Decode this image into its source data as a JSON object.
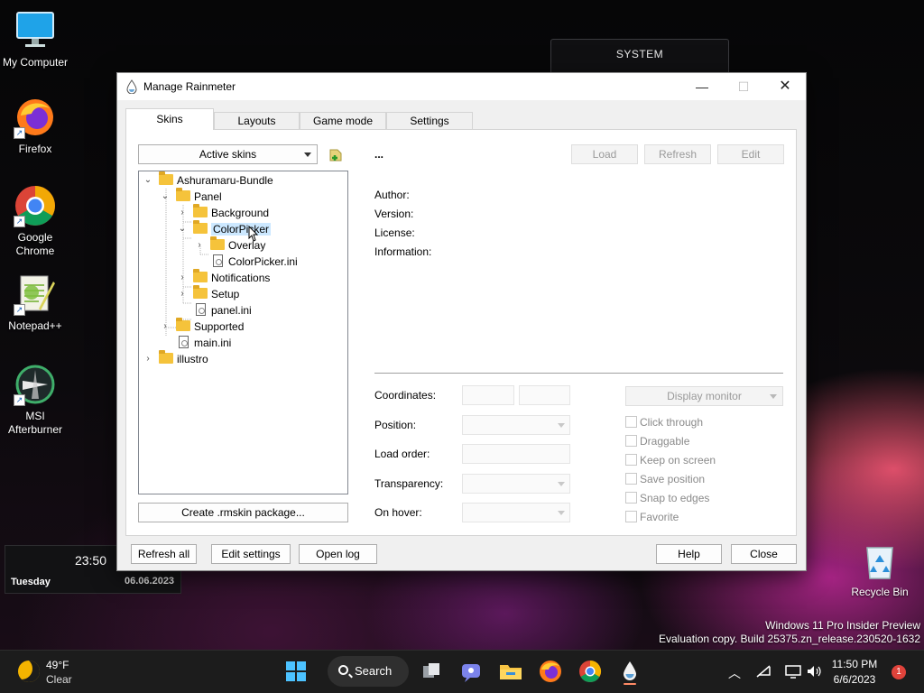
{
  "desktop": {
    "icons": [
      {
        "label": "My Computer",
        "icon": "monitor-icon"
      },
      {
        "label": "Firefox",
        "icon": "firefox-icon"
      },
      {
        "label": "Google Chrome",
        "icon": "chrome-icon"
      },
      {
        "label": "Notepad++",
        "icon": "notepad-plus-plus-icon"
      },
      {
        "label": "MSI Afterburner",
        "icon": "msi-afterburner-icon"
      },
      {
        "label": "Recycle Bin",
        "icon": "recycle-bin-icon"
      }
    ],
    "system_widget": {
      "title": "SYSTEM"
    },
    "clock_widget": {
      "time": "23:50",
      "day": "Tuesday",
      "date": "06.06.2023"
    },
    "watermark": {
      "line1": "Windows 11 Pro Insider Preview",
      "line2": "Evaluation copy. Build 25375.zn_release.230520-1632"
    }
  },
  "window": {
    "title": "Manage Rainmeter",
    "tabs": [
      {
        "label": "Skins",
        "active": true
      },
      {
        "label": "Layouts",
        "active": false
      },
      {
        "label": "Game mode",
        "active": false
      },
      {
        "label": "Settings",
        "active": false
      }
    ],
    "skins": {
      "active_skins_dropdown": "Active skins",
      "tree": [
        {
          "label": "Ashuramaru-Bundle",
          "type": "folder",
          "expanded": true,
          "level": 0
        },
        {
          "label": "Panel",
          "type": "folder",
          "expanded": true,
          "level": 1
        },
        {
          "label": "Background",
          "type": "folder",
          "expanded": false,
          "level": 2
        },
        {
          "label": "ColorPicker",
          "type": "folder",
          "expanded": true,
          "level": 2,
          "selected": true
        },
        {
          "label": "Overlay",
          "type": "folder",
          "expanded": false,
          "level": 3
        },
        {
          "label": "ColorPicker.ini",
          "type": "file",
          "level": 3
        },
        {
          "label": "Notifications",
          "type": "folder",
          "expanded": false,
          "level": 2
        },
        {
          "label": "Setup",
          "type": "folder",
          "expanded": false,
          "level": 2
        },
        {
          "label": "panel.ini",
          "type": "file",
          "level": 2
        },
        {
          "label": "Supported",
          "type": "folder",
          "expanded": false,
          "level": 1
        },
        {
          "label": "main.ini",
          "type": "file",
          "level": 1
        },
        {
          "label": "illustro",
          "type": "folder",
          "expanded": false,
          "level": 0
        }
      ],
      "create_package_button": "Create .rmskin package...",
      "skin_name": "...",
      "buttons": {
        "load": "Load",
        "refresh": "Refresh",
        "edit": "Edit"
      },
      "info_labels": {
        "author": "Author:",
        "version": "Version:",
        "license": "License:",
        "information": "Information:"
      },
      "settings_labels": {
        "coordinates": "Coordinates:",
        "position": "Position:",
        "load_order": "Load order:",
        "transparency": "Transparency:",
        "on_hover": "On hover:"
      },
      "display_monitor": "Display monitor",
      "checkboxes": [
        {
          "label": "Click through",
          "checked": false
        },
        {
          "label": "Draggable",
          "checked": false
        },
        {
          "label": "Keep on screen",
          "checked": false
        },
        {
          "label": "Save position",
          "checked": false
        },
        {
          "label": "Snap to edges",
          "checked": false
        },
        {
          "label": "Favorite",
          "checked": false
        }
      ]
    },
    "footer": {
      "refresh_all": "Refresh all",
      "edit_settings": "Edit settings",
      "open_log": "Open log",
      "help": "Help",
      "close": "Close"
    }
  },
  "taskbar": {
    "weather": {
      "temp": "49°F",
      "condition": "Clear"
    },
    "search_label": "Search",
    "apps": [
      "windows-start-icon",
      "task-view-icon",
      "chat-icon",
      "file-explorer-icon",
      "firefox-icon",
      "chrome-icon",
      "rainmeter-icon"
    ],
    "clock": {
      "time": "11:50 PM",
      "date": "6/6/2023"
    },
    "notification_count": "1"
  }
}
